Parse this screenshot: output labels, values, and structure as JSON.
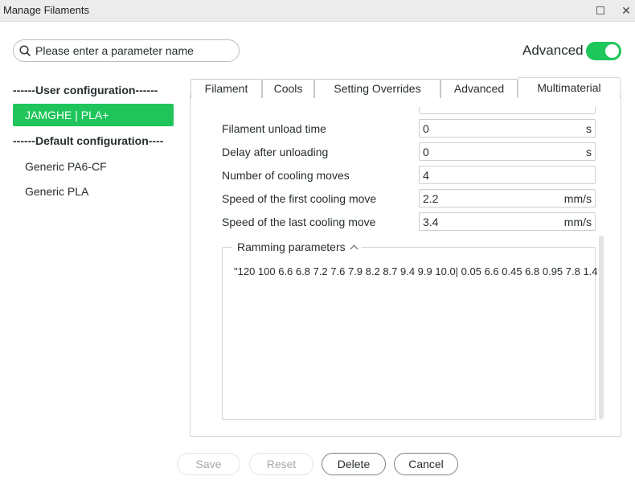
{
  "window": {
    "title": "Manage Filaments"
  },
  "search": {
    "placeholder": "Please enter a parameter name"
  },
  "advanced": {
    "label": "Advanced",
    "enabled": true
  },
  "sidebar": {
    "user_group": "------User configuration------",
    "user_items": [
      {
        "label": "JAMGHE | PLA+",
        "selected": true
      }
    ],
    "default_group": "------Default configuration----",
    "default_items": [
      {
        "label": "Generic PA6-CF"
      },
      {
        "label": "Generic PLA"
      }
    ]
  },
  "tabs": [
    {
      "label": "Filament"
    },
    {
      "label": "Cools"
    },
    {
      "label": "Setting Overrides"
    },
    {
      "label": "Advanced"
    },
    {
      "label": "Multimaterial",
      "active": true
    }
  ],
  "fields": [
    {
      "label": "Filament unload time",
      "value": "0",
      "unit": "s"
    },
    {
      "label": "Delay after unloading",
      "value": "0",
      "unit": "s"
    },
    {
      "label": "Number of cooling moves",
      "value": "4",
      "unit": ""
    },
    {
      "label": "Speed of the first cooling move",
      "value": "2.2",
      "unit": "mm/s"
    },
    {
      "label": "Speed of the last cooling move",
      "value": "3.4",
      "unit": "mm/s"
    }
  ],
  "ramming": {
    "title": "Ramming parameters",
    "value": "\"120 100 6.6 6.8 7.2 7.6 7.9 8.2 8.7 9.4 9.9 10.0| 0.05 6.6 0.45 6.8 0.95 7.8 1.4"
  },
  "buttons": {
    "save": "Save",
    "reset": "Reset",
    "delete": "Delete",
    "cancel": "Cancel"
  },
  "colors": {
    "accent": "#1fc55b",
    "toggle": "#1ec75a"
  },
  "icons": {
    "search": "search-icon",
    "maximize": "maximize-icon",
    "close": "close-icon",
    "collapse": "chevron-up-icon"
  }
}
